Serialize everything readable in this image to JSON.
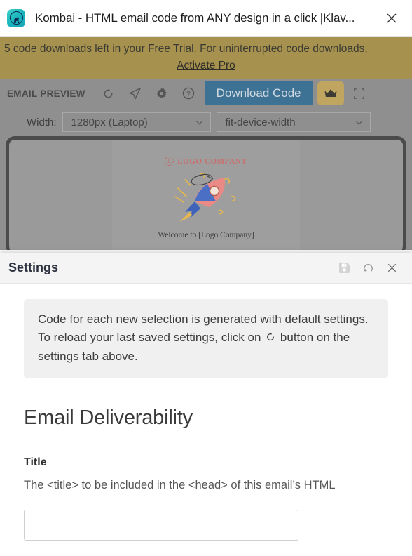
{
  "window": {
    "title": "Kombai - HTML email code from ANY design in a click |Klav...",
    "app_icon": "kombai-app-icon",
    "close_label": "×"
  },
  "banner": {
    "message": "5 code downloads left in your Free Trial. For uninterrupted code downloads,",
    "link_label": "Activate Pro",
    "background": "#a6914f"
  },
  "toolbar": {
    "title": "EMAIL PREVIEW",
    "icons": [
      {
        "name": "refresh-icon",
        "label": "Refresh"
      },
      {
        "name": "send-icon",
        "label": "Send test email"
      },
      {
        "name": "gear-icon",
        "label": "Settings"
      },
      {
        "name": "help-icon",
        "label": "Help"
      }
    ],
    "download_label": "Download Code",
    "download_color": "#3e7294",
    "crown_label": "Upgrade",
    "crown_color": "#bfa560",
    "collapse_label": "Collapse"
  },
  "width_row": {
    "label": "Width:",
    "device_value": "1280px (Laptop)",
    "device_options": [
      "1280px (Laptop)"
    ],
    "fit_value": "fit-device-width",
    "fit_options": [
      "fit-device-width"
    ]
  },
  "preview": {
    "logo_mark": "L",
    "logo_text": "LOGO COMPANY",
    "illustration": "rocket-illustration",
    "welcome_text": "Welcome to [Logo Company]"
  },
  "settings": {
    "title": "Settings",
    "header_icons": [
      {
        "name": "save-icon",
        "label": "Save settings"
      },
      {
        "name": "reload-icon",
        "label": "Reload saved settings"
      },
      {
        "name": "close-icon",
        "label": "Close"
      }
    ],
    "info_text_part1": "Code for each new selection is generated with default settings. To reload your last saved settings, click on",
    "info_text_part2": "button on the settings tab above.",
    "section_title": "Email Deliverability",
    "field_label": "Title",
    "field_description": "The <title> to be included in the <head> of this email’s HTML",
    "field_value": "",
    "field_placeholder": ""
  }
}
